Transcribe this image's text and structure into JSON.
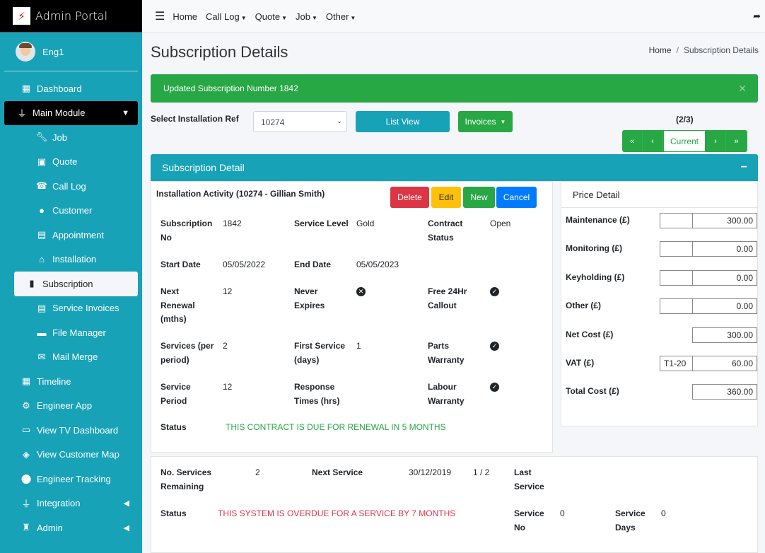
{
  "sidebar": {
    "brand": "Admin Portal",
    "brand_logo": "⚡",
    "user": "Eng1",
    "items": [
      {
        "label": "Dashboard",
        "icon": "grid-icon"
      },
      {
        "label": "Main Module",
        "icon": "plug-icon"
      },
      {
        "label": "Job",
        "icon": "wrench-icon"
      },
      {
        "label": "Quote",
        "icon": "calculator-icon"
      },
      {
        "label": "Call Log",
        "icon": "user-call-icon"
      },
      {
        "label": "Customer",
        "icon": "users-icon"
      },
      {
        "label": "Appointment",
        "icon": "calendar-check-icon"
      },
      {
        "label": "Installation",
        "icon": "home-icon"
      },
      {
        "label": "Subscription",
        "icon": "file-icon"
      },
      {
        "label": "Service Invoices",
        "icon": "file-text-icon"
      },
      {
        "label": "File Manager",
        "icon": "folder-icon"
      },
      {
        "label": "Mail Merge",
        "icon": "mail-merge-icon"
      },
      {
        "label": "Timeline",
        "icon": "calendar-icon"
      },
      {
        "label": "Engineer App",
        "icon": "user-cog-icon"
      },
      {
        "label": "View TV Dashboard",
        "icon": "tv-icon"
      },
      {
        "label": "View Customer Map",
        "icon": "map-icon"
      },
      {
        "label": "Engineer Tracking",
        "icon": "map-marker-icon"
      },
      {
        "label": "Integration",
        "icon": "plug-icon"
      },
      {
        "label": "Admin",
        "icon": "admin-icon"
      }
    ]
  },
  "topbar": {
    "links": [
      "Home",
      "Call Log",
      "Quote",
      "Job",
      "Other"
    ]
  },
  "page": {
    "title": "Subscription Details",
    "breadcrumb": [
      "Home",
      "Subscription Details"
    ],
    "alert": "Updated Subscription Number 1842",
    "select_label": "Select Installation Ref",
    "select_value": "10274",
    "list_view": "List View",
    "invoices": "Invoices",
    "pager_count": "(2/3)",
    "pager_current": "Current"
  },
  "detail": {
    "header": "Subscription Detail",
    "activity_title": "Installation Activity (10274 - Gillian Smith)",
    "buttons": {
      "delete": "Delete",
      "edit": "Edit",
      "new": "New",
      "cancel": "Cancel"
    },
    "subscription_no_label": "Subscription No",
    "subscription_no": "1842",
    "service_level_label": "Service Level",
    "service_level": "Gold",
    "contract_status_label": "Contract Status",
    "contract_status": "Open",
    "start_date_label": "Start Date",
    "start_date": "05/05/2022",
    "end_date_label": "End Date",
    "end_date": "05/05/2023",
    "next_renewal_label": "Next Renewal (mths)",
    "next_renewal": "12",
    "never_expires_label": "Never Expires",
    "never_expires": false,
    "free_callout_label": "Free 24Hr Callout",
    "free_callout": true,
    "services_label": "Services (per period)",
    "services": "2",
    "first_service_label": "First Service (days)",
    "first_service": "1",
    "parts_warranty_label": "Parts Warranty",
    "parts_warranty": true,
    "service_period_label": "Service Period",
    "service_period": "12",
    "response_times_label": "Response Times (hrs)",
    "labour_warranty_label": "Labour Warranty",
    "labour_warranty": true,
    "status_label": "Status",
    "status": "THIS CONTRACT IS DUE FOR RENEWAL IN 5 MONTHS"
  },
  "price": {
    "header": "Price Detail",
    "maintenance_label": "Maintenance (£)",
    "maintenance": "300.00",
    "monitoring_label": "Monitoring (£)",
    "monitoring": "0.00",
    "keyholding_label": "Keyholding (£)",
    "keyholding": "0.00",
    "other_label": "Other (£)",
    "other": "0.00",
    "net_label": "Net Cost (£)",
    "net": "300.00",
    "vat_label": "VAT (£)",
    "vat_code": "T1-20",
    "vat": "60.00",
    "total_label": "Total Cost (£)",
    "total": "360.00"
  },
  "service": {
    "remaining_label": "No. Services Remaining",
    "remaining": "2",
    "next_label": "Next Service",
    "next": "30/12/2019",
    "ratio": "1 / 2",
    "last_label": "Last Service",
    "status_label": "Status",
    "status": "THIS SYSTEM IS OVERDUE FOR A SERVICE BY 7 MONTHS",
    "service_no_label": "Service No",
    "service_no": "0",
    "service_days_label": "Service Days",
    "service_days": "0"
  }
}
